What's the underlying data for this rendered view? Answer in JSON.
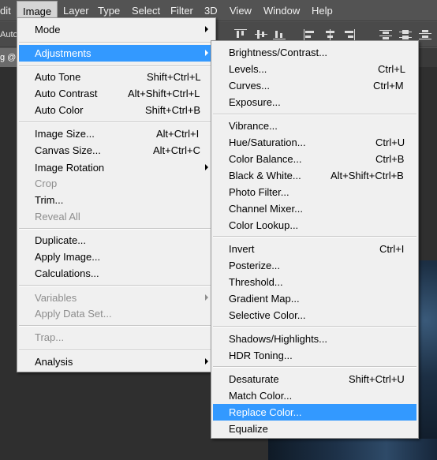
{
  "menubar": {
    "items": [
      "dit",
      "Image",
      "Layer",
      "Type",
      "Select",
      "Filter",
      "3D",
      "View",
      "Window",
      "Help"
    ]
  },
  "options_bar": {
    "text": "Auto-"
  },
  "doc_tab": {
    "label": "g @"
  },
  "image_menu": {
    "mode": "Mode",
    "adjustments": "Adjustments",
    "auto_tone": {
      "label": "Auto Tone",
      "shortcut": "Shift+Ctrl+L"
    },
    "auto_contrast": {
      "label": "Auto Contrast",
      "shortcut": "Alt+Shift+Ctrl+L"
    },
    "auto_color": {
      "label": "Auto Color",
      "shortcut": "Shift+Ctrl+B"
    },
    "image_size": {
      "label": "Image Size...",
      "shortcut": "Alt+Ctrl+I"
    },
    "canvas_size": {
      "label": "Canvas Size...",
      "shortcut": "Alt+Ctrl+C"
    },
    "image_rotation": "Image Rotation",
    "crop": "Crop",
    "trim": "Trim...",
    "reveal_all": "Reveal All",
    "duplicate": "Duplicate...",
    "apply_image": "Apply Image...",
    "calculations": "Calculations...",
    "variables": "Variables",
    "apply_data_set": "Apply Data Set...",
    "trap": "Trap...",
    "analysis": "Analysis"
  },
  "adjustments_menu": {
    "brightness_contrast": {
      "label": "Brightness/Contrast...",
      "shortcut": ""
    },
    "levels": {
      "label": "Levels...",
      "shortcut": "Ctrl+L"
    },
    "curves": {
      "label": "Curves...",
      "shortcut": "Ctrl+M"
    },
    "exposure": {
      "label": "Exposure...",
      "shortcut": ""
    },
    "vibrance": {
      "label": "Vibrance...",
      "shortcut": ""
    },
    "hue_saturation": {
      "label": "Hue/Saturation...",
      "shortcut": "Ctrl+U"
    },
    "color_balance": {
      "label": "Color Balance...",
      "shortcut": "Ctrl+B"
    },
    "black_white": {
      "label": "Black & White...",
      "shortcut": "Alt+Shift+Ctrl+B"
    },
    "photo_filter": {
      "label": "Photo Filter...",
      "shortcut": ""
    },
    "channel_mixer": {
      "label": "Channel Mixer...",
      "shortcut": ""
    },
    "color_lookup": {
      "label": "Color Lookup...",
      "shortcut": ""
    },
    "invert": {
      "label": "Invert",
      "shortcut": "Ctrl+I"
    },
    "posterize": {
      "label": "Posterize...",
      "shortcut": ""
    },
    "threshold": {
      "label": "Threshold...",
      "shortcut": ""
    },
    "gradient_map": {
      "label": "Gradient Map...",
      "shortcut": ""
    },
    "selective_color": {
      "label": "Selective Color...",
      "shortcut": ""
    },
    "shadows_highlights": {
      "label": "Shadows/Highlights...",
      "shortcut": ""
    },
    "hdr_toning": {
      "label": "HDR Toning...",
      "shortcut": ""
    },
    "desaturate": {
      "label": "Desaturate",
      "shortcut": "Shift+Ctrl+U"
    },
    "match_color": {
      "label": "Match Color...",
      "shortcut": ""
    },
    "replace_color": {
      "label": "Replace Color...",
      "shortcut": ""
    },
    "equalize": {
      "label": "Equalize",
      "shortcut": ""
    }
  },
  "colors": {
    "highlight": "#3399ff",
    "menu_bg": "#f0f0f0",
    "disabled_text": "#8d8d8d",
    "app_bg": "#535353"
  }
}
